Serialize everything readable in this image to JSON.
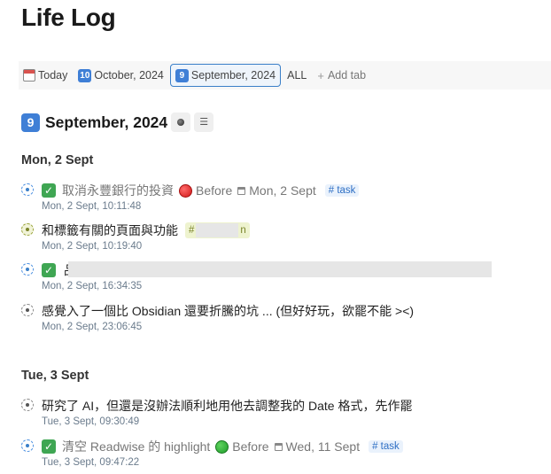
{
  "page": {
    "title": "Life Log"
  },
  "tabs": [
    {
      "icon": "calendar-icon",
      "label": "Today",
      "active": false
    },
    {
      "icon": "keycap-10-icon",
      "keycap": "10",
      "label": "October, 2024",
      "active": false
    },
    {
      "icon": "keycap-9-icon",
      "keycap": "9",
      "label": "September, 2024",
      "active": true
    },
    {
      "label": "ALL",
      "active": false
    }
  ],
  "add_tab_label": "Add tab",
  "section": {
    "keycap": "9",
    "title": "September, 2024"
  },
  "days": [
    {
      "heading": "Mon, 2 Sept",
      "entries": [
        {
          "text": "取消永豐銀行的投資",
          "done": true,
          "priority": "red",
          "before_label": "Before",
          "due": "Mon, 2 Sept",
          "tag": "# task",
          "time": "Mon, 2 Sept, 10:11:48"
        },
        {
          "text": "和標籤有關的頁面與功能",
          "tag_fragment_left": "#",
          "tag_fragment_right": "n",
          "time": "Mon, 2 Sept, 10:19:40"
        },
        {
          "text_fragment": "品",
          "done": true,
          "time": "Mon, 2 Sept, 16:34:35"
        },
        {
          "text": "感覺入了一個比 Obsidian 還要折騰的坑 ... (但好好玩，欲罷不能 ><)",
          "time": "Mon, 2 Sept, 23:06:45"
        }
      ]
    },
    {
      "heading": "Tue, 3 Sept",
      "entries": [
        {
          "text": "研究了 AI，但還是沒辦法順利地用他去調整我的 Date 格式，先作罷",
          "time": "Tue, 3 Sept, 09:30:49"
        },
        {
          "text": "清空 Readwise 的 highlight",
          "done": true,
          "priority": "green",
          "before_label": "Before",
          "due": "Wed, 11 Sept",
          "tag": "# task",
          "time": "Tue, 3 Sept, 09:47:22"
        }
      ]
    }
  ]
}
